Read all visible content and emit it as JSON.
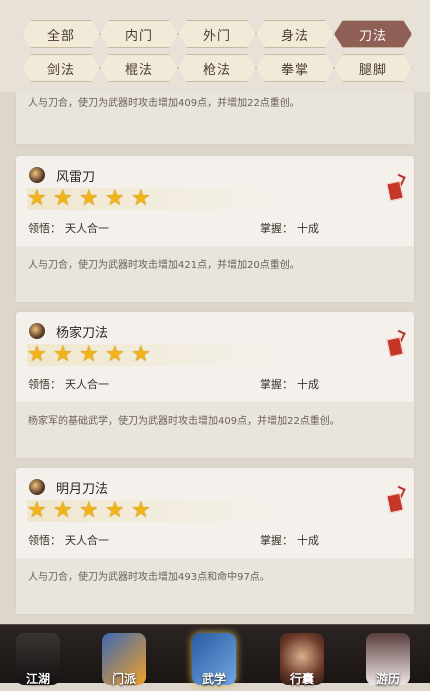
{
  "tabs_row1": [
    "全部",
    "内门",
    "外门",
    "身法",
    "刀法"
  ],
  "tabs_row2": [
    "剑法",
    "棍法",
    "枪法",
    "拳掌",
    "腿脚"
  ],
  "active_tab": "刀法",
  "top_partial_desc": "人与刀合，使刀为武器时攻击增加409点，并增加22点重创。",
  "cards": [
    {
      "name": "风雷刀",
      "stars": 5,
      "comprehension_label": "领悟：",
      "comprehension_value": "天人合一",
      "mastery_label": "掌握：",
      "mastery_value": "十成",
      "description": "人与刀合，使刀为武器时攻击增加421点，并增加20点重创。"
    },
    {
      "name": "杨家刀法",
      "stars": 5,
      "comprehension_label": "领悟：",
      "comprehension_value": "天人合一",
      "mastery_label": "掌握：",
      "mastery_value": "十成",
      "description": "杨家军的基础武学，使刀为武器时攻击增加409点，并增加22点重创。"
    },
    {
      "name": "明月刀法",
      "stars": 5,
      "comprehension_label": "领悟：",
      "comprehension_value": "天人合一",
      "mastery_label": "掌握：",
      "mastery_value": "十成",
      "description": "人与刀合，使刀为武器时攻击增加493点和命中97点。"
    }
  ],
  "bottom_nav": [
    "江湖",
    "门派",
    "武学",
    "行囊",
    "游历"
  ],
  "colors": {
    "accent": "#8f5e55",
    "star": "#f2b318",
    "seal": "#c63628"
  }
}
